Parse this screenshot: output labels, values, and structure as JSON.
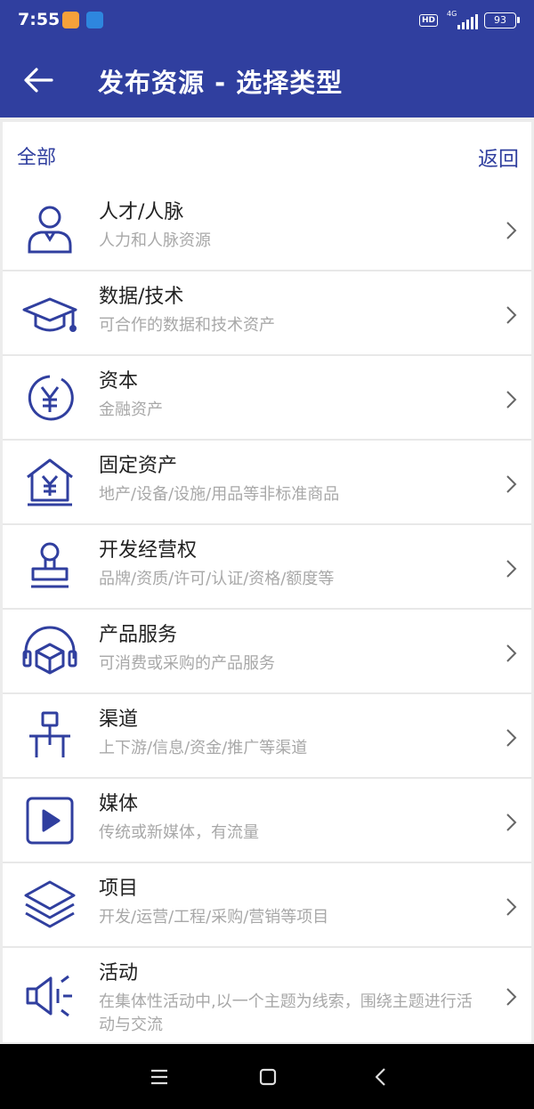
{
  "status_bar": {
    "time": "7:55",
    "hd_label": "HD",
    "network_label": "4G",
    "battery": "93",
    "notification_icons": [
      "orange-message-icon",
      "blue-app-icon"
    ]
  },
  "header": {
    "title": "发布资源 - 选择类型",
    "back_icon": "arrow-left-icon",
    "background": "#303f9f"
  },
  "filter": {
    "current": "全部",
    "return_label": "返回"
  },
  "accent_color": "#303f9f",
  "categories": [
    {
      "name": "人才/人脉",
      "desc": "人力和人脉资源",
      "icon": "person-icon"
    },
    {
      "name": "数据/技术",
      "desc": "可合作的数据和技术资产",
      "icon": "graduation-cap-icon"
    },
    {
      "name": "资本",
      "desc": "金融资产",
      "icon": "yen-coin-icon"
    },
    {
      "name": "固定资产",
      "desc": "地产/设备/设施/用品等非标准商品",
      "icon": "house-yen-icon"
    },
    {
      "name": "开发经营权",
      "desc": "品牌/资质/许可/认证/资格/额度等",
      "icon": "stamp-icon"
    },
    {
      "name": "产品服务",
      "desc": "可消费或采购的产品服务",
      "icon": "headset-box-icon"
    },
    {
      "name": "渠道",
      "desc": "上下游/信息/资金/推广等渠道",
      "icon": "hierarchy-icon"
    },
    {
      "name": "媒体",
      "desc": "传统或新媒体，有流量",
      "icon": "play-video-icon"
    },
    {
      "name": "项目",
      "desc": "开发/运营/工程/采购/营销等项目",
      "icon": "layers-icon"
    },
    {
      "name": "活动",
      "desc": "在集体性活动中,以一个主题为线索，围绕主题进行活动与交流",
      "icon": "megaphone-icon"
    }
  ],
  "nav_bar": {
    "icons": [
      "menu-icon",
      "home-square-icon",
      "back-triangle-icon"
    ]
  }
}
